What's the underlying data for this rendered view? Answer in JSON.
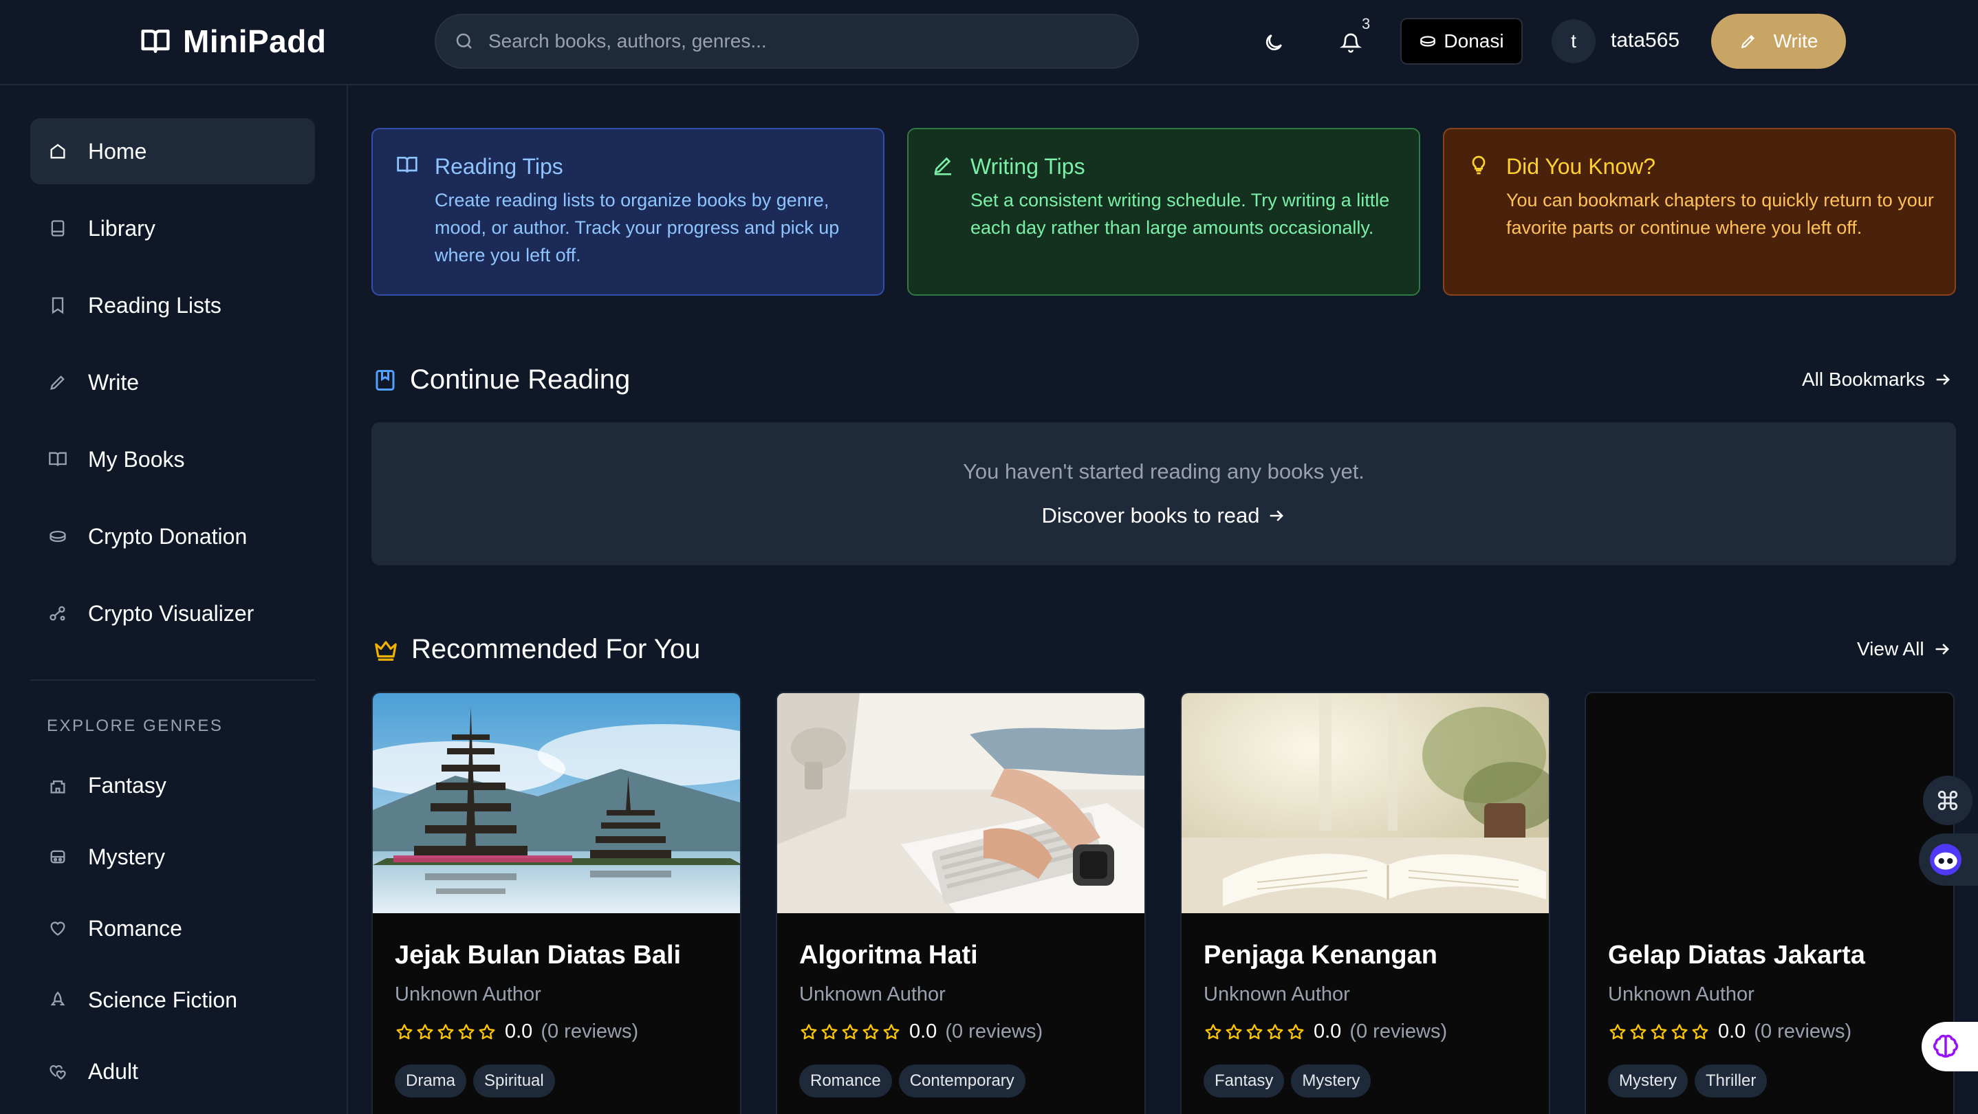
{
  "header": {
    "logo_text": "MiniPadd",
    "search_placeholder": "Search books, authors, genres...",
    "notification_count": "3",
    "donate_label": "Donasi",
    "avatar_initial": "t",
    "username": "tata565",
    "write_label": "Write"
  },
  "sidebar": {
    "nav": [
      {
        "label": "Home",
        "icon": "home-icon"
      },
      {
        "label": "Library",
        "icon": "library-icon"
      },
      {
        "label": "Reading Lists",
        "icon": "bookmark-icon"
      },
      {
        "label": "Write",
        "icon": "pencil-icon"
      },
      {
        "label": "My Books",
        "icon": "book-open-icon"
      },
      {
        "label": "Crypto Donation",
        "icon": "coins-icon"
      },
      {
        "label": "Crypto Visualizer",
        "icon": "network-icon"
      }
    ],
    "explore_label": "EXPLORE GENRES",
    "genres": [
      {
        "label": "Fantasy",
        "icon": "castle-icon"
      },
      {
        "label": "Mystery",
        "icon": "mask-icon"
      },
      {
        "label": "Romance",
        "icon": "heart-icon"
      },
      {
        "label": "Science Fiction",
        "icon": "rocket-icon"
      },
      {
        "label": "Adult",
        "icon": "hearts-icon"
      }
    ]
  },
  "tips": [
    {
      "title": "Reading Tips",
      "text": "Create reading lists to organize books by genre, mood, or author. Track your progress and pick up where you left off.",
      "icon": "book-open-icon"
    },
    {
      "title": "Writing Tips",
      "text": "Set a consistent writing schedule. Try writing a little each day rather than large amounts occasionally.",
      "icon": "pencil-icon"
    },
    {
      "title": "Did You Know?",
      "text": "You can bookmark chapters to quickly return to your favorite parts or continue where you left off.",
      "icon": "lightbulb-icon"
    }
  ],
  "continue_reading": {
    "title": "Continue Reading",
    "link": "All Bookmarks",
    "empty_text": "You haven't started reading any books yet.",
    "discover_link": "Discover books to read"
  },
  "recommended": {
    "title": "Recommended For You",
    "link": "View All",
    "books": [
      {
        "title": "Jejak Bulan Diatas Bali",
        "author": "Unknown Author",
        "score": "0.0",
        "reviews": "(0 reviews)",
        "tags": [
          "Drama",
          "Spiritual"
        ],
        "cover": "temple-lake"
      },
      {
        "title": "Algoritma Hati",
        "author": "Unknown Author",
        "score": "0.0",
        "reviews": "(0 reviews)",
        "tags": [
          "Romance",
          "Contemporary"
        ],
        "cover": "keyboard-desk"
      },
      {
        "title": "Penjaga Kenangan",
        "author": "Unknown Author",
        "score": "0.0",
        "reviews": "(0 reviews)",
        "tags": [
          "Fantasy",
          "Mystery"
        ],
        "cover": "open-book"
      },
      {
        "title": "Gelap Diatas Jakarta",
        "author": "Unknown Author",
        "score": "0.0",
        "reviews": "(0 reviews)",
        "tags": [
          "Mystery",
          "Thriller"
        ],
        "cover": "dark"
      }
    ]
  },
  "colors": {
    "background": "#101828",
    "panel": "#1e2939",
    "accent_gold": "#c9a565",
    "star": "#fdc700"
  }
}
